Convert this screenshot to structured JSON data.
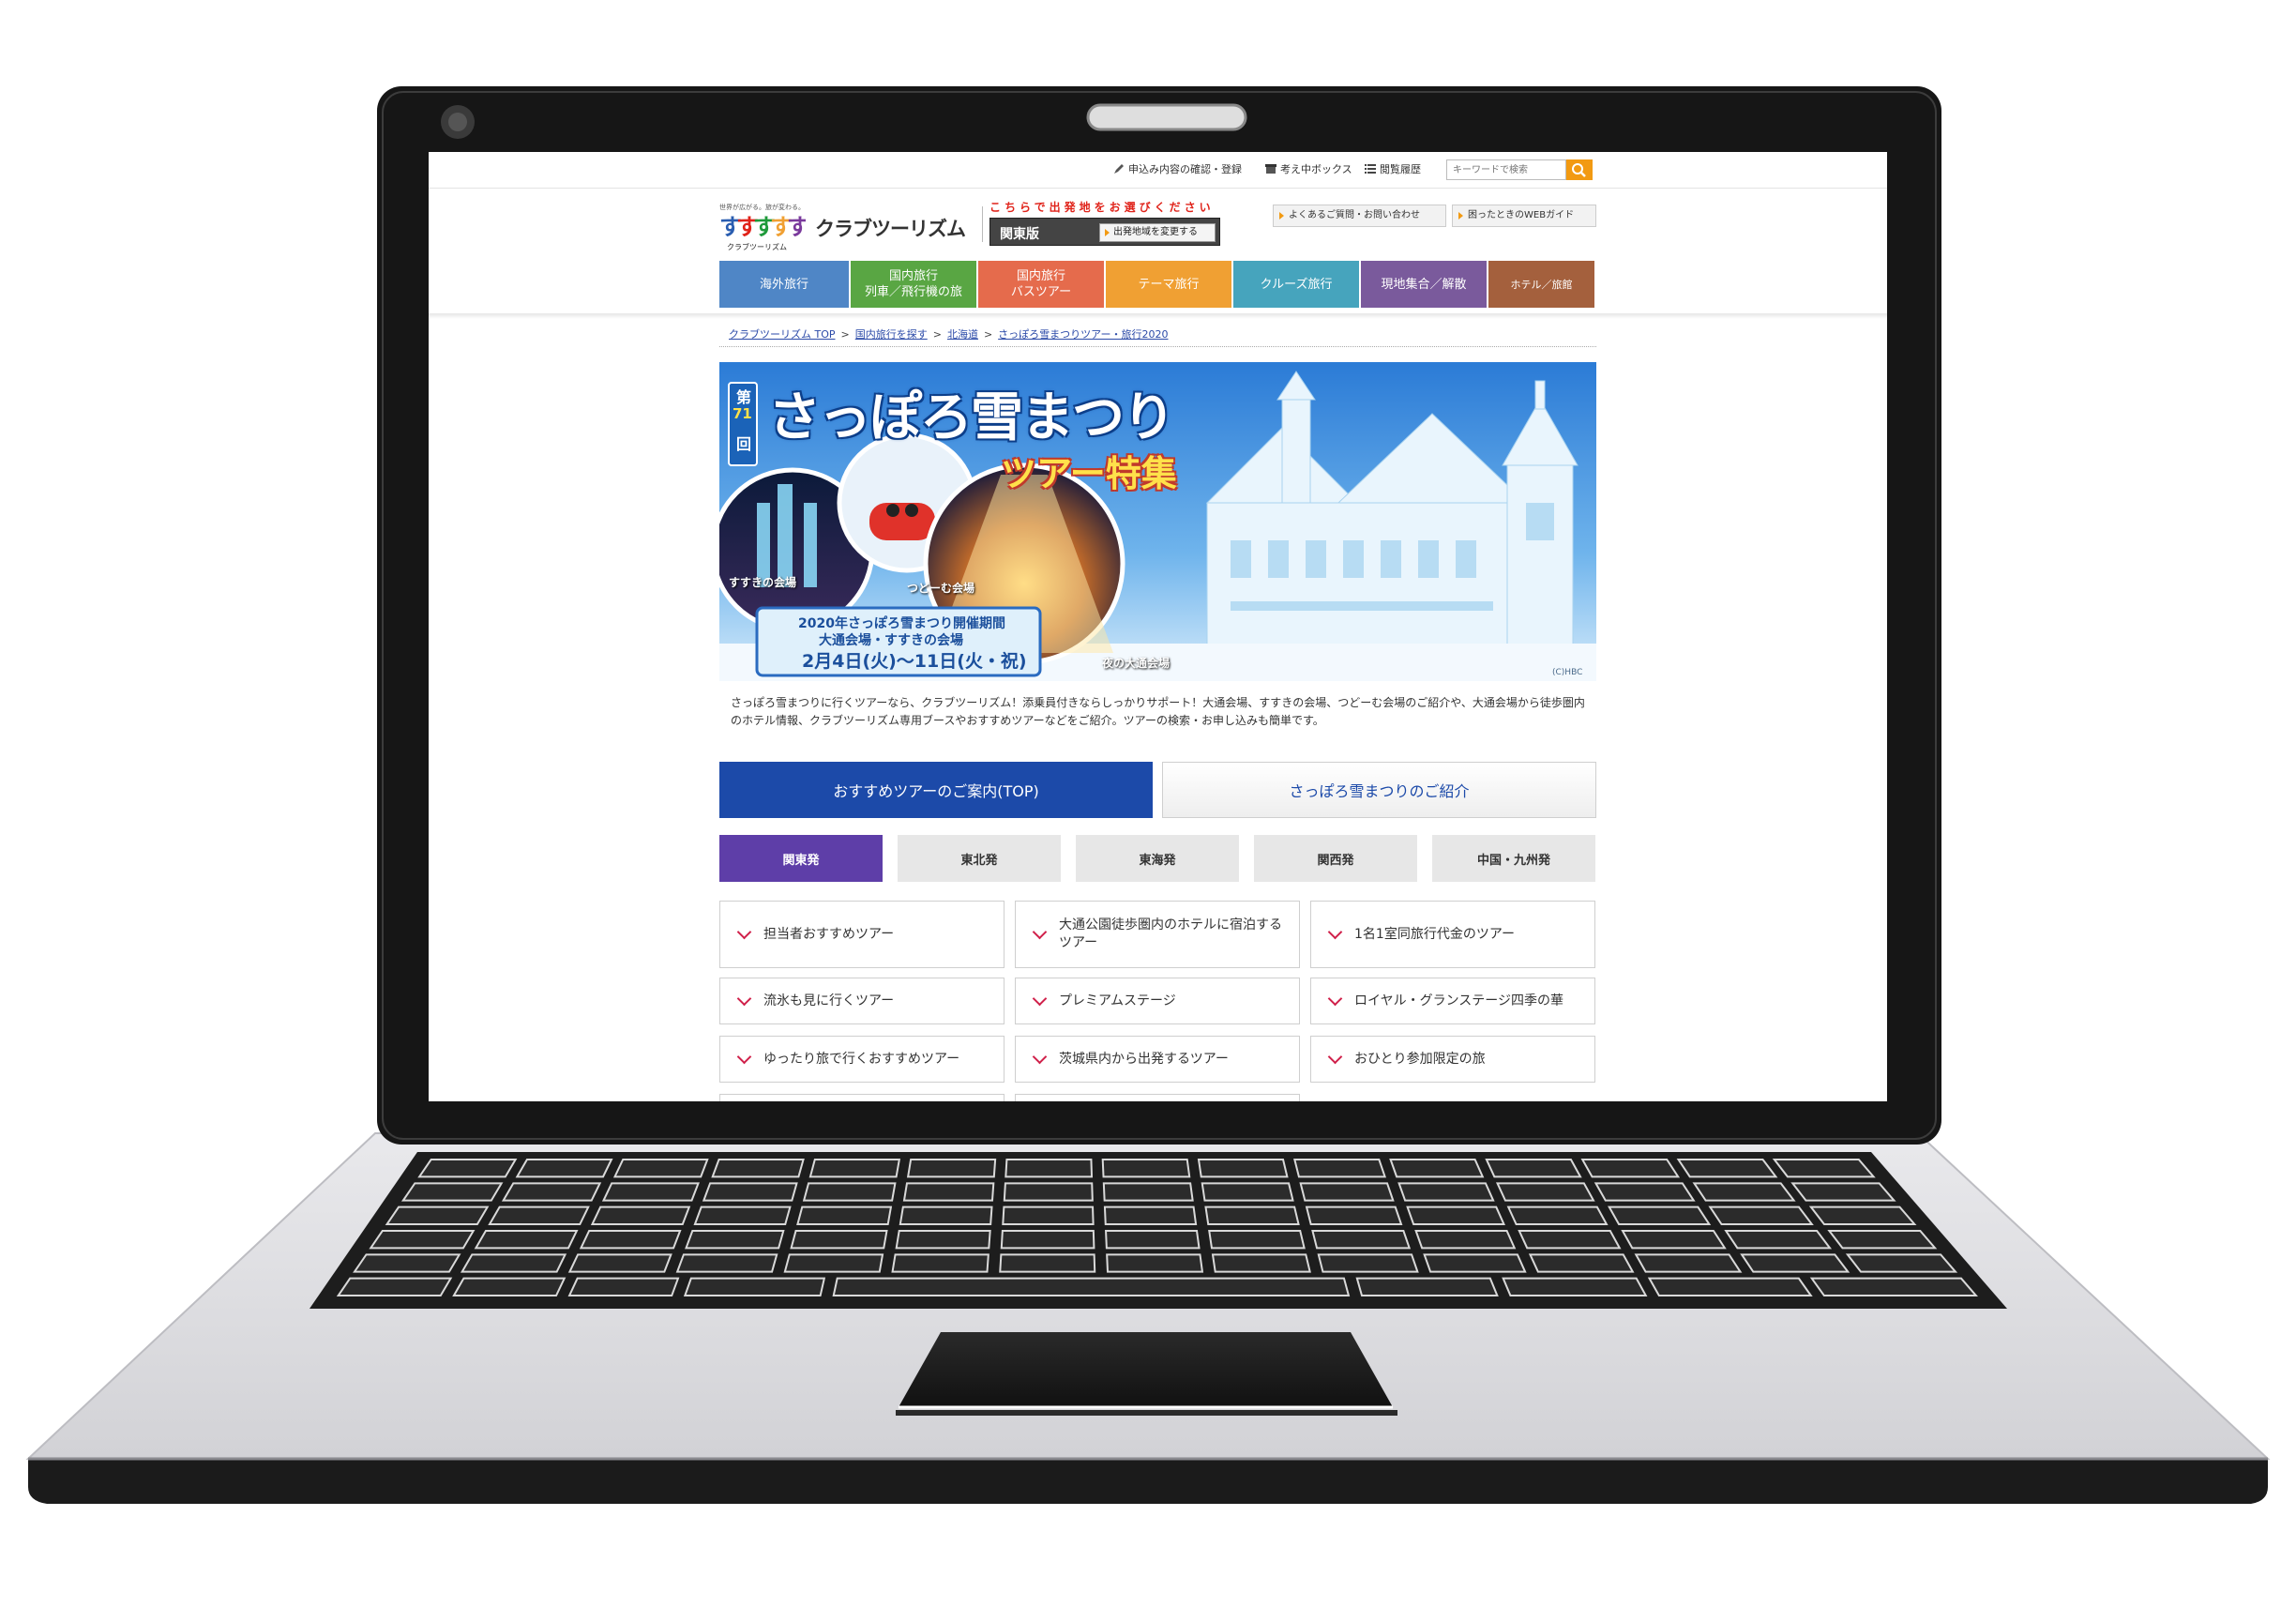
{
  "utility": {
    "apply_check": "申込み内容の確認・登録",
    "consider_box": "考え中ボックス",
    "history": "閲覧履歴",
    "search_placeholder": "キーワードで検索"
  },
  "brand": {
    "tagline": "世界が広がる。旅が変わる。",
    "name_small": "クラブツーリズム",
    "name": "クラブツーリズム"
  },
  "region": {
    "notice": "こちらで出発地をお選びください",
    "current": "関東版",
    "change_label": "出発地域を変更する"
  },
  "help": {
    "faq": "よくあるご質問・お問い合わせ",
    "web_guide": "困ったときのWEBガイド"
  },
  "nav": {
    "items": [
      {
        "label": "海外旅行",
        "color": "#4f86c6"
      },
      {
        "label": "国内旅行\n列車／飛行機の旅",
        "color": "#59a643"
      },
      {
        "label": "国内旅行\nバスツアー",
        "color": "#e56b4c"
      },
      {
        "label": "テーマ旅行",
        "color": "#f0a033"
      },
      {
        "label": "クルーズ旅行",
        "color": "#46a4bd"
      },
      {
        "label": "現地集合／解散",
        "color": "#7a5a9c"
      },
      {
        "label": "ホテル／旅館",
        "color": "#a4603d"
      }
    ]
  },
  "breadcrumb": {
    "items": [
      "クラブツーリズム TOP",
      "国内旅行を探す",
      "北海道",
      "さっぽろ雪まつりツアー・旅行2020"
    ]
  },
  "banner": {
    "edition_top": "第",
    "edition_num": "71",
    "edition_bottom": "回",
    "title": "さっぽろ雪まつり",
    "subtitle": "ツアー特集",
    "venue_susukino": "すすきの会場",
    "venue_tsudome": "つどーむ会場",
    "venue_odori": "夜の大通会場",
    "period_line1": "2020年さっぽろ雪まつり開催期間",
    "period_line2": "大通会場・すすきの会場",
    "period_dates": "2月4日(火)～11日(火・祝)",
    "copyright": "(C)HBC"
  },
  "intro": "さっぽろ雪まつりに行くツアーなら、クラブツーリズム！添乗員付きならしっかりサポート！大通会場、すすきの会場、つどーむ会場のご紹介や、大通会場から徒歩圏内のホテル情報、クラブツーリズム専用ブースやおすすめツアーなどをご紹介。ツアーの検索・お申し込みも簡単です。",
  "tabs": {
    "recommended": "おすすめツアーのご案内(TOP)",
    "introduction": "さっぽろ雪まつりのご紹介"
  },
  "departures": [
    "関東発",
    "東北発",
    "東海発",
    "関西発",
    "中国・九州発"
  ],
  "tours": [
    "担当者おすすめツアー",
    "大通公園徒歩圏内のホテルに宿泊するツアー",
    "1名1室同旅行代金のツアー",
    "流氷も見に行くツアー",
    "プレミアムステージ",
    "ロイヤル・グランステージ四季の華",
    "ゆったり旅で行くおすすめツアー",
    "茨城県内から出発するツアー",
    "おひとり参加限定の旅"
  ],
  "colors": {
    "accent_blue": "#1c4aa9",
    "active_region": "#5e3ea8",
    "chevron": "#d0204a",
    "search_button": "#f29a12"
  }
}
